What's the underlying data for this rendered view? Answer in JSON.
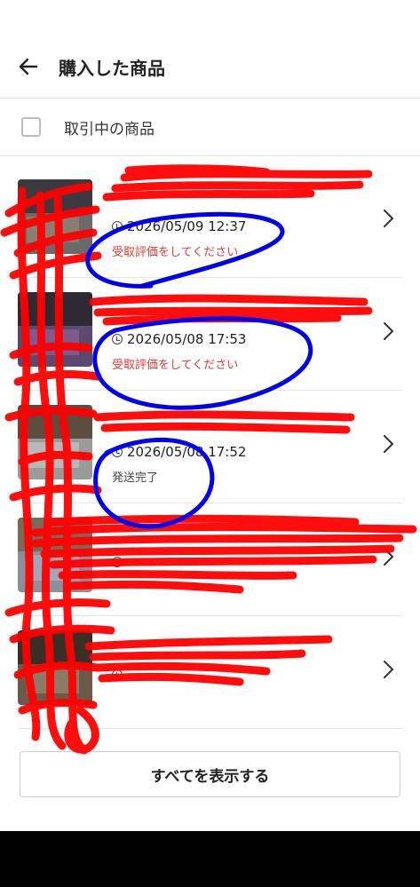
{
  "header": {
    "title": "購入した商品"
  },
  "filter": {
    "label": "取引中の商品",
    "checked": false
  },
  "items": [
    {
      "name": "",
      "date": "2026/05/09 12:37",
      "status": "受取評価をしてください",
      "status_color": "#e53935"
    },
    {
      "name": "",
      "date": "2026/05/08 17:53",
      "status": "受取評価をしてください",
      "status_color": "#e53935"
    },
    {
      "name": "",
      "date": "2026/05/08 17:52",
      "status": "発送完了",
      "status_color": "#444444"
    },
    {
      "name": "",
      "date": "",
      "status": "",
      "status_color": "#444444"
    },
    {
      "name": "",
      "date": "",
      "status": "",
      "status_color": "#444444"
    }
  ],
  "show_all_label": "すべてを表示する",
  "colors": {
    "accent_red": "#e53935",
    "scribble_red": "#ff0000",
    "scribble_blue": "#0000ee"
  }
}
